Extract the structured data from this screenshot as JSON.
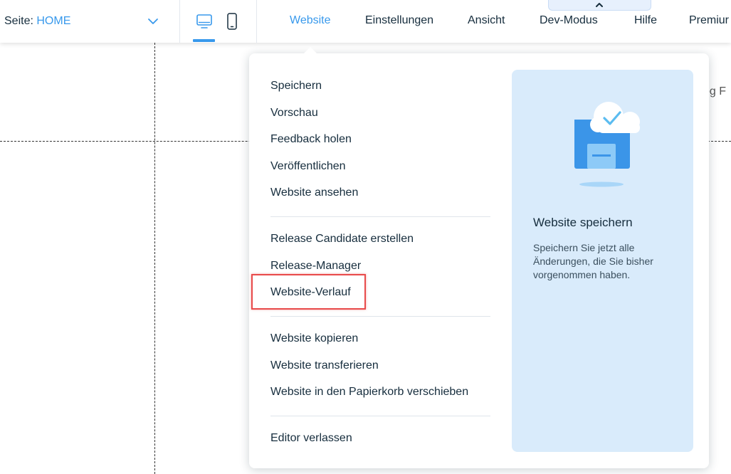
{
  "page_selector": {
    "label": "Seite:",
    "page_name": "HOME"
  },
  "top_menu": [
    {
      "label": "Website",
      "active": true
    },
    {
      "label": "Einstellungen",
      "active": false
    },
    {
      "label": "Ansicht",
      "active": false
    },
    {
      "label": "Dev-Modus",
      "active": false
    },
    {
      "label": "Hilfe",
      "active": false
    },
    {
      "label": "Premiur",
      "active": false
    }
  ],
  "background": {
    "partial_text": "og F"
  },
  "dropdown": {
    "groups": [
      [
        "Speichern",
        "Vorschau",
        "Feedback holen",
        "Veröffentlichen",
        "Website ansehen"
      ],
      [
        "Release Candidate erstellen",
        "Release-Manager",
        "Website-Verlauf"
      ],
      [
        "Website kopieren",
        "Website transferieren",
        "Website in den Papierkorb verschieben"
      ],
      [
        "Editor verlassen"
      ]
    ],
    "highlighted_item": "Website-Verlauf",
    "info_panel": {
      "title": "Website speichern",
      "description": "Speichern Sie jetzt alle Änderungen, die Sie bisher vorgenommen haben."
    }
  },
  "icons": {
    "page_dropdown": "chevron-down-icon",
    "desktop": "desktop-icon",
    "mobile": "mobile-icon",
    "collapse": "chevron-up-icon",
    "illustration": "cloud-save-icon"
  },
  "colors": {
    "accent": "#3899ec",
    "highlight": "#e84b4b",
    "panel_bg": "#d9ebfb",
    "text": "#162d3d"
  }
}
